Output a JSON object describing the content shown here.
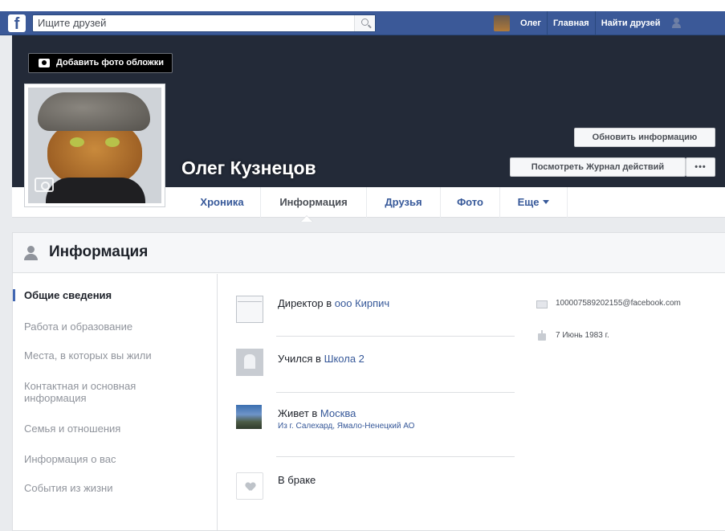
{
  "topbar": {
    "logo": "f",
    "search_placeholder": "Ищите друзей",
    "user_name": "Олег",
    "nav_home": "Главная",
    "nav_find_friends": "Найти друзей"
  },
  "cover": {
    "add_cover_label": "Добавить фото обложки",
    "name": "Олег Кузнецов",
    "update_info_label": "Обновить информацию",
    "activity_log_label": "Посмотреть Журнал действий",
    "more_label": "•••"
  },
  "tabs": [
    {
      "label": "Хроника"
    },
    {
      "label": "Информация"
    },
    {
      "label": "Друзья"
    },
    {
      "label": "Фото"
    },
    {
      "label": "Еще"
    }
  ],
  "panel": {
    "title": "Информация",
    "sidebar": [
      {
        "label": "Общие сведения"
      },
      {
        "label": "Работа и образование"
      },
      {
        "label": "Места, в которых вы жили"
      },
      {
        "label": "Контактная и основная информация"
      },
      {
        "label": "Семья и отношения"
      },
      {
        "label": "Информация о вас"
      },
      {
        "label": "События из жизни"
      }
    ],
    "overview": {
      "work_prefix": "Директор в ",
      "work_link": "ооо Кирпич",
      "edu_prefix": "Учился в ",
      "edu_link": "Школа 2",
      "lives_prefix": "Живет в ",
      "lives_link": "Москва",
      "from_text": "Из г. Салехард, Ямало-Ненецкий АО",
      "relationship": "В браке"
    },
    "contact": {
      "email": "100007589202155@facebook.com",
      "birthday": "7 Июнь 1983 г."
    }
  }
}
